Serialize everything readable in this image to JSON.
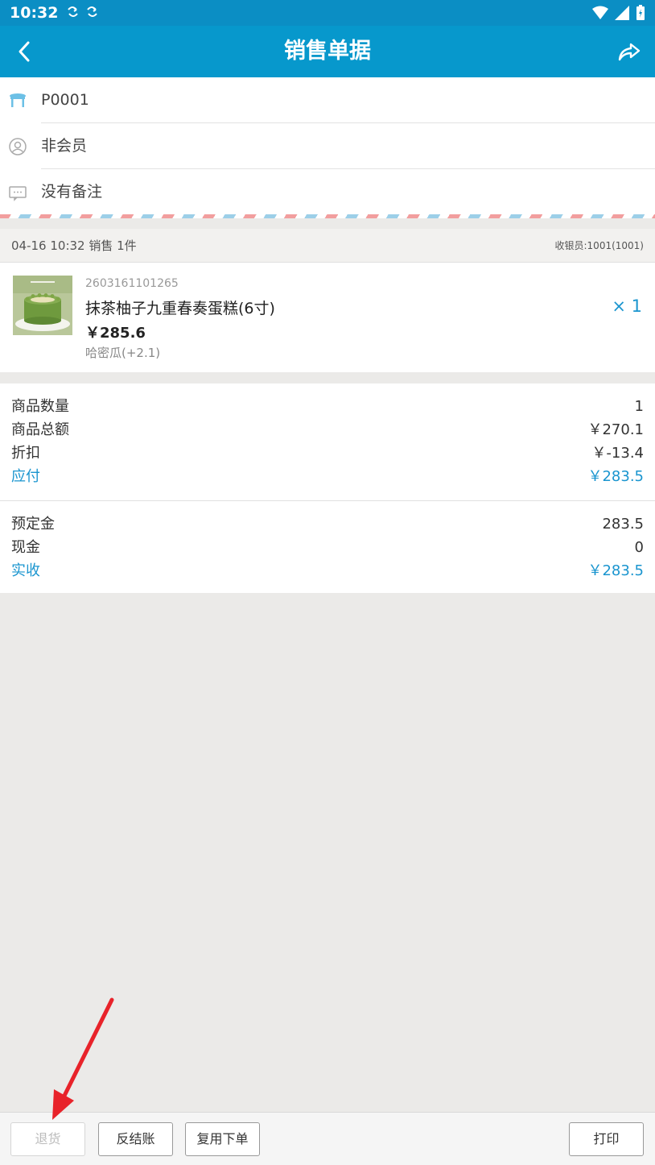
{
  "status_bar": {
    "time": "10:32",
    "notification_icons": [
      "sync-icon",
      "sync-icon"
    ],
    "right_icons": [
      "wifi-icon",
      "signal-icon",
      "battery-icon"
    ]
  },
  "header": {
    "title": "销售单据",
    "back_icon": "back-arrow-icon",
    "share_icon": "share-icon",
    "bg_color": "#0798cc"
  },
  "info": {
    "table_no": "P0001",
    "member": "非会员",
    "note": "没有备注"
  },
  "order_meta": {
    "left": "04-16 10:32 销售 1件",
    "cashier": "收银员:1001(1001)"
  },
  "item": {
    "barcode": "2603161101265",
    "name": "抹茶柚子九重春奏蛋糕(6寸)",
    "price": "￥285.6",
    "addon": "哈密瓜(+2.1)",
    "qty": "× 1"
  },
  "summary": {
    "rows": [
      {
        "label": "商品数量",
        "value": "1"
      },
      {
        "label": "商品总额",
        "value": "￥270.1"
      },
      {
        "label": "折扣",
        "value": "￥-13.4"
      },
      {
        "label": "应付",
        "value": "￥283.5"
      }
    ]
  },
  "payment": {
    "rows": [
      {
        "label": "预定金",
        "value": "283.5"
      },
      {
        "label": "现金",
        "value": "0"
      },
      {
        "label": "实收",
        "value": "￥283.5"
      }
    ]
  },
  "actions": {
    "refund": "退货",
    "reverse_checkout": "反结账",
    "reorder": "复用下单",
    "print": "打印"
  },
  "accent_color": "#1a95cf"
}
